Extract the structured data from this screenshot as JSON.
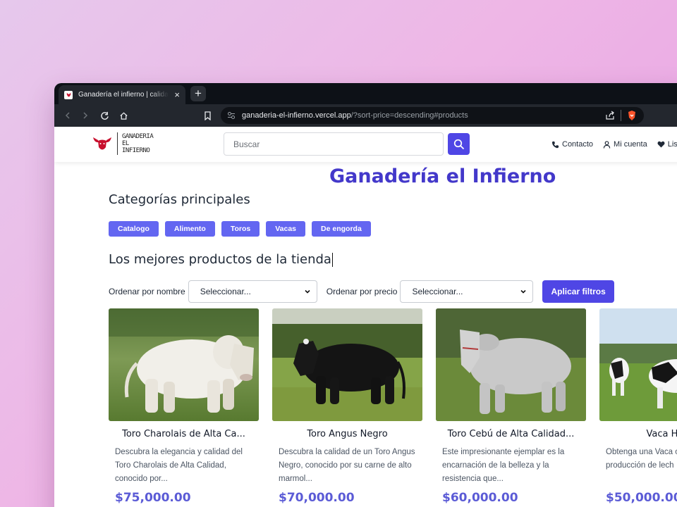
{
  "browser": {
    "tab_title": "Ganadería el infierno | calidad p",
    "url_host": "ganaderia-el-infierno.vercel.app",
    "url_path": "/?sort-price=descending#products"
  },
  "header": {
    "logo_text": [
      "GANADERIA",
      "EL",
      "INFIERNO"
    ],
    "search_placeholder": "Buscar",
    "links": {
      "contact": "Contacto",
      "account": "Mi cuenta",
      "list": "Lis"
    }
  },
  "main": {
    "brand_title": "Ganadería el Infierno",
    "categories_title": "Categorías principales",
    "categories": [
      "Catalogo",
      "Alimento",
      "Toros",
      "Vacas",
      "De engorda"
    ],
    "products_title": "Los mejores productos de la tienda",
    "filters": {
      "by_name_label": "Ordenar por nombre",
      "by_name_value": "Seleccionar...",
      "by_price_label": "Ordenar por precio",
      "by_price_value": "Seleccionar...",
      "apply_label": "Aplicar filtros"
    },
    "products": [
      {
        "name": "Toro Charolais de Alta Ca...",
        "description": "Descubra la elegancia y calidad del Toro Charolais de Alta Calidad, conocido por...",
        "price": "$75,000.00"
      },
      {
        "name": "Toro Angus Negro",
        "description": "Descubra la calidad de un Toro Angus Negro, conocido por su carne de alto marmol...",
        "price": "$70,000.00"
      },
      {
        "name": "Toro Cebú de Alta Calidad...",
        "description": "Este impresionante ejemplar es la encarnación de la belleza y la resistencia que...",
        "price": "$60,000.00"
      },
      {
        "name": "Vaca Holstei",
        "description": "Obtenga una Vaca calidad conocida p producción de lech",
        "price": "$50,000.00"
      }
    ]
  },
  "colors": {
    "accent": "#4f46e5",
    "category_chip": "#6366f1",
    "title": "#4338ca",
    "price": "#5b5bd6"
  }
}
